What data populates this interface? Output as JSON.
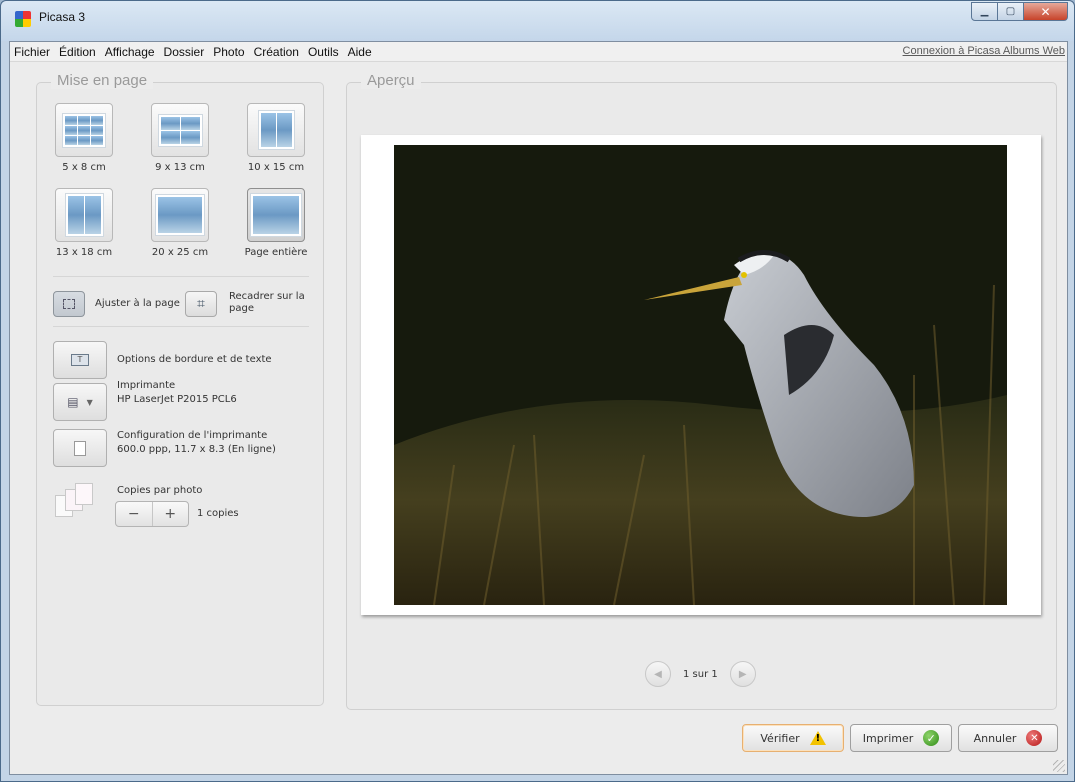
{
  "window": {
    "title": "Picasa 3"
  },
  "menu": {
    "items": [
      "Fichier",
      "Édition",
      "Affichage",
      "Dossier",
      "Photo",
      "Création",
      "Outils",
      "Aide"
    ],
    "link": "Connexion à Picasa Albums Web"
  },
  "left": {
    "title": "Mise en page",
    "tiles": [
      {
        "label": "5 x 8 cm"
      },
      {
        "label": "9 x 13 cm"
      },
      {
        "label": "10 x 15 cm"
      },
      {
        "label": "13 x 18 cm"
      },
      {
        "label": "20 x 25 cm"
      },
      {
        "label": "Page entière"
      }
    ],
    "fit_label": "Ajuster à la page",
    "crop_label": "Recadrer sur la page",
    "border_options": "Options de bordure et de texte",
    "printer_label": "Imprimante",
    "printer_name": "HP LaserJet P2015 PCL6",
    "config_label": "Configuration de l'imprimante",
    "config_detail": "600.0 ppp, 11.7 x 8.3 (En ligne)",
    "copies_label": "Copies par photo",
    "copies_value": "1 copies"
  },
  "preview": {
    "title": "Aperçu",
    "pager": "1 sur 1"
  },
  "buttons": {
    "verify": "Vérifier",
    "print": "Imprimer",
    "cancel": "Annuler"
  },
  "icons": {
    "verify": "warning-icon",
    "print": "check-icon",
    "cancel": "cancel-icon"
  }
}
